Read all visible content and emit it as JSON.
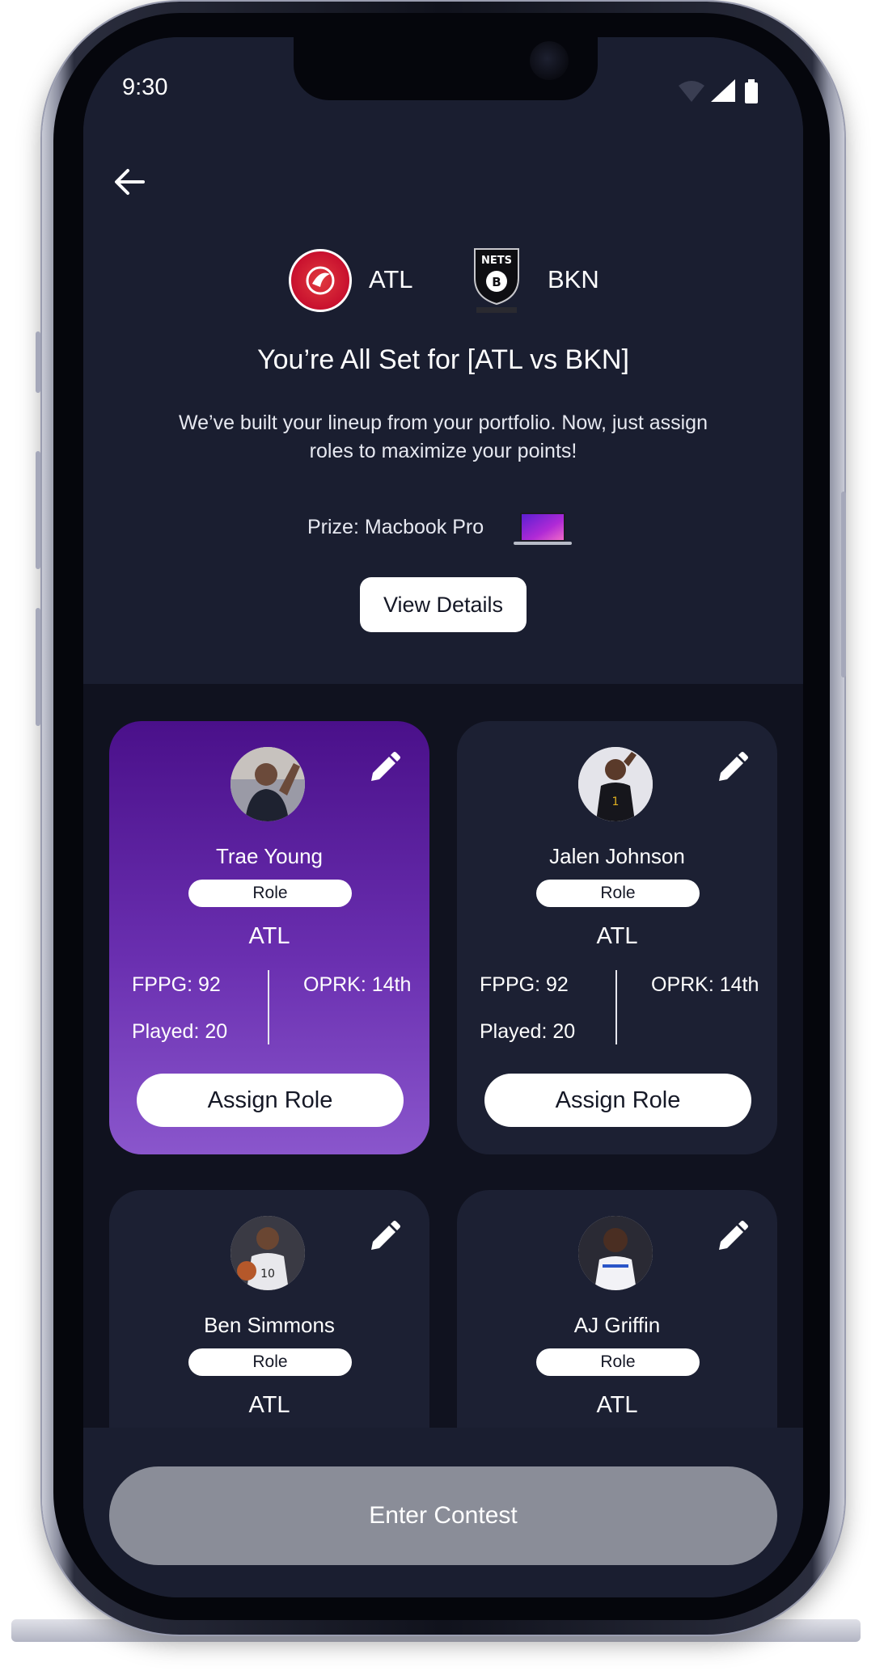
{
  "status_bar": {
    "time": "9:30"
  },
  "matchup": {
    "home_abbr": "ATL",
    "away_abbr": "BKN",
    "title": "You’re All Set for [ATL vs BKN]",
    "subtitle": "We’ve built your lineup from your portfolio. Now, just assign roles to maximize your points!",
    "prize_label": "Prize: Macbook Pro",
    "view_details_label": "View Details"
  },
  "players": [
    {
      "name": "Trae Young",
      "role_label": "Role",
      "team": "ATL",
      "fppg": "FPPG: 92",
      "played": "Played: 20",
      "oprk": "OPRK: 14th",
      "assign_label": "Assign Role",
      "selected": true
    },
    {
      "name": "Jalen Johnson",
      "role_label": "Role",
      "team": "ATL",
      "fppg": "FPPG: 92",
      "played": "Played: 20",
      "oprk": "OPRK: 14th",
      "assign_label": "Assign Role",
      "selected": false
    },
    {
      "name": "Ben Simmons",
      "role_label": "Role",
      "team": "ATL",
      "selected": false
    },
    {
      "name": "AJ Griffin",
      "role_label": "Role",
      "team": "ATL",
      "selected": false
    }
  ],
  "footer": {
    "enter_contest_label": "Enter Contest"
  },
  "colors": {
    "background": "#1a1e30",
    "cards_background": "#10121f",
    "card": "#1c2033",
    "selected_card_top": "#4a108a",
    "selected_card_bottom": "#8a56cc",
    "disabled_button": "#8a8d98"
  },
  "icons": [
    "back-arrow-icon",
    "atl-hawks-logo",
    "bkn-nets-logo",
    "macbook-icon",
    "edit-pencil-icon",
    "wifi-icon",
    "signal-icon",
    "battery-icon"
  ]
}
